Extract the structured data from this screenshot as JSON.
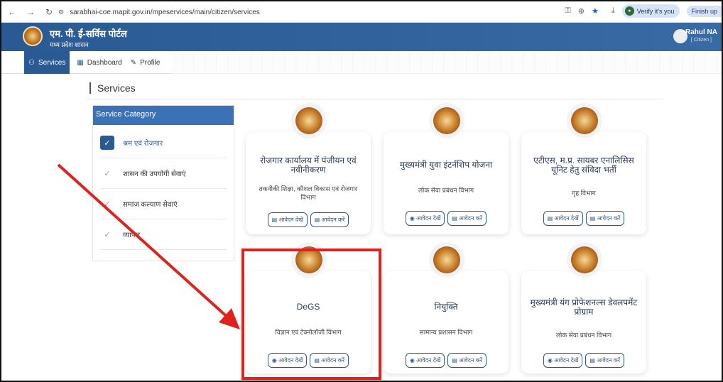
{
  "browser": {
    "url": "sarabhai-coe.mapit.gov.in/mpeservices/main/citizen/services",
    "verify_label": "Verify it's you",
    "finish_label": "Finish up"
  },
  "header": {
    "title": "एम. पी. ई-सर्विस पोर्टल",
    "subtitle": "मध्य प्रदेश शासन",
    "user_name": "Rahul NA",
    "user_role": "[ Citizen ]"
  },
  "nav": {
    "tabs": [
      {
        "label": "Services"
      },
      {
        "label": "Dashboard"
      },
      {
        "label": "Profile"
      }
    ]
  },
  "page": {
    "title": "Services"
  },
  "sidebar": {
    "heading": "Service Category",
    "items": [
      {
        "label": "श्रम एवं रोजगार"
      },
      {
        "label": "शासन की उपयोगी सेवाएं"
      },
      {
        "label": "समाज कल्याण सेवाएं"
      },
      {
        "label": "व्यापार"
      }
    ]
  },
  "cards": [
    {
      "name": "रोजगार कार्यालय में पंजीयन एवं नवीनीकरण",
      "dept": "तकनीकी शिक्षा, कौशल विकास एवं रोजगार विभाग",
      "view": "आवेदन देखें",
      "apply": "आवेदन करें"
    },
    {
      "name": "मुख्यमंत्री युवा इंटर्नशिप योजना",
      "dept": "लोक सेवा प्रबंधन विभाग",
      "view": "आवेदन देखें",
      "apply": "आवेदन करें"
    },
    {
      "name": "एटीएस, म.प्र. सायबर एनालिसिस यूनिट हेतु संविदा भर्ती",
      "dept": "गृह विभाग",
      "view": "आवेदन देखें",
      "apply": "आवेदन करें"
    },
    {
      "name": "DeGS",
      "dept": "विज्ञान एवं टेक्नोलॉजी विभाग",
      "view": "आवेदन देखें",
      "apply": "आवेदन करें"
    },
    {
      "name": "नियुक्ति",
      "dept": "सामान्य प्रशासन विभाग",
      "view": "आवेदन देखें",
      "apply": "आवेदन करें"
    },
    {
      "name": "मुख्यमंत्री यंग प्रोफेशनल्स डेवलपमेंट प्रोग्राम",
      "dept": "लोक सेवा प्रबंधन विभाग",
      "view": "आवेदन देखें",
      "apply": "आवेदन करें"
    }
  ],
  "annotation": {
    "color": "#e0211d"
  },
  "colors": {
    "brand": "#2a5a94",
    "accent": "#3c72b5"
  }
}
